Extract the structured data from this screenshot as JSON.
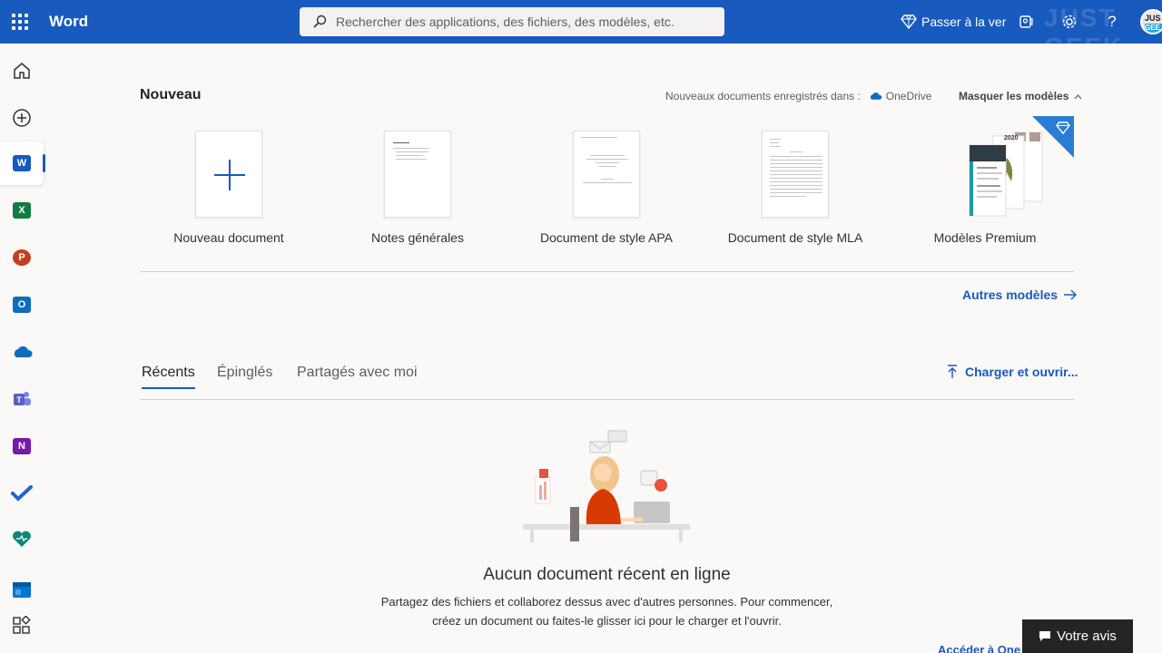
{
  "header": {
    "app_name": "Word",
    "search_placeholder": "Rechercher des applications, des fichiers, des modèles, etc.",
    "premium_label": "Passer à la vers",
    "watermark": "JUST GEEK",
    "avatar_top": "JUS",
    "avatar_bottom": "GEE"
  },
  "rail": {
    "items": [
      "home",
      "create",
      "word",
      "excel",
      "powerpoint",
      "outlook",
      "onedrive",
      "teams",
      "onenote",
      "todo",
      "family-safety",
      "calendar",
      "all-apps"
    ],
    "app_letters": {
      "word": "W",
      "excel": "X",
      "powerpoint": "P",
      "outlook": "O",
      "onenote": "N"
    }
  },
  "new_section": {
    "title": "Nouveau",
    "save_note": "Nouveaux documents enregistrés dans :",
    "save_location": "OneDrive",
    "hide_models": "Masquer les modèles",
    "templates": [
      {
        "label": "Nouveau document"
      },
      {
        "label": "Notes générales"
      },
      {
        "label": "Document de style APA"
      },
      {
        "label": "Document de style MLA"
      },
      {
        "label": "Modèles Premium"
      }
    ],
    "premium_year": "2020",
    "more_models": "Autres modèles"
  },
  "recent": {
    "tabs": [
      "Récents",
      "Épinglés",
      "Partagés avec moi"
    ],
    "active_tab": "Récents",
    "upload": "Charger et ouvrir...",
    "empty_title": "Aucun document récent en ligne",
    "empty_desc": "Partagez des fichiers et collaborez dessus avec d'autres personnes. Pour commencer, créez un document ou faites-le glisser ici pour le charger et l'ouvrir.",
    "bottom_link": "Accéder à OneDrive"
  },
  "feedback": {
    "label": "Votre avis"
  },
  "colors": {
    "brand": "#185abd",
    "word": "#185abd",
    "excel": "#107c41",
    "powerpoint": "#c43e1c",
    "outlook": "#0f6cbd",
    "onenote": "#7719aa",
    "teams": "#5b5fc7"
  }
}
